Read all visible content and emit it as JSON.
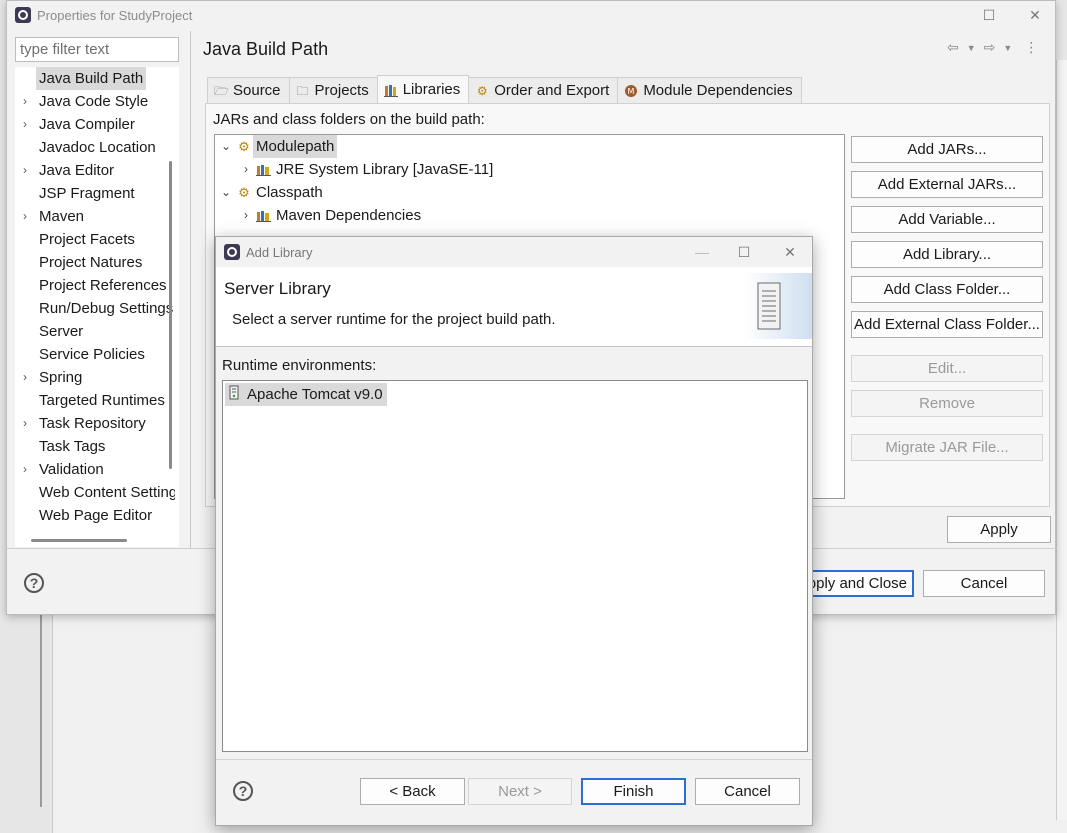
{
  "properties_window": {
    "title": "Properties for StudyProject",
    "filter_placeholder": "type filter text",
    "nav_items": [
      {
        "label": "Java Build Path",
        "expandable": false,
        "selected": true
      },
      {
        "label": "Java Code Style",
        "expandable": true
      },
      {
        "label": "Java Compiler",
        "expandable": true
      },
      {
        "label": "Javadoc Location",
        "expandable": false
      },
      {
        "label": "Java Editor",
        "expandable": true
      },
      {
        "label": "JSP Fragment",
        "expandable": false
      },
      {
        "label": "Maven",
        "expandable": true
      },
      {
        "label": "Project Facets",
        "expandable": false
      },
      {
        "label": "Project Natures",
        "expandable": false
      },
      {
        "label": "Project References",
        "expandable": false
      },
      {
        "label": "Run/Debug Settings",
        "expandable": false
      },
      {
        "label": "Server",
        "expandable": false
      },
      {
        "label": "Service Policies",
        "expandable": false
      },
      {
        "label": "Spring",
        "expandable": true
      },
      {
        "label": "Targeted Runtimes",
        "expandable": false
      },
      {
        "label": "Task Repository",
        "expandable": true
      },
      {
        "label": "Task Tags",
        "expandable": false
      },
      {
        "label": "Validation",
        "expandable": true
      },
      {
        "label": "Web Content Settings",
        "expandable": false
      },
      {
        "label": "Web Page Editor",
        "expandable": false
      }
    ],
    "page_title": "Java Build Path",
    "tabs": [
      {
        "label": "Source",
        "icon": "source-folder-icon"
      },
      {
        "label": "Projects",
        "icon": "projects-icon"
      },
      {
        "label": "Libraries",
        "icon": "libraries-icon",
        "active": true
      },
      {
        "label": "Order and Export",
        "icon": "order-export-icon"
      },
      {
        "label": "Module Dependencies",
        "icon": "module-icon"
      }
    ],
    "build_path_label": "JARs and class folders on the build path:",
    "tree": [
      {
        "label": "Modulepath",
        "icon": "modulepath-icon",
        "expanded": true,
        "level": 0,
        "selected": true
      },
      {
        "label": "JRE System Library [JavaSE-11]",
        "icon": "library-icon",
        "expanded": false,
        "level": 1
      },
      {
        "label": "Classpath",
        "icon": "classpath-icon",
        "expanded": true,
        "level": 0
      },
      {
        "label": "Maven Dependencies",
        "icon": "library-icon",
        "expanded": false,
        "level": 1
      }
    ],
    "buttons": {
      "add_jars": "Add JARs...",
      "add_external_jars": "Add External JARs...",
      "add_variable": "Add Variable...",
      "add_library": "Add Library...",
      "add_class_folder": "Add Class Folder...",
      "add_external_class_folder": "Add External Class Folder...",
      "edit": "Edit...",
      "remove": "Remove",
      "migrate_jar": "Migrate JAR File...",
      "apply": "Apply",
      "apply_and_close": "Apply and Close",
      "cancel": "Cancel"
    }
  },
  "add_library_dialog": {
    "title": "Add Library",
    "banner_title": "Server Library",
    "banner_description": "Select a server runtime for the project build path.",
    "runtime_label": "Runtime environments:",
    "runtimes": [
      {
        "label": "Apache Tomcat v9.0",
        "selected": true
      }
    ],
    "buttons": {
      "back": "< Back",
      "next": "Next >",
      "finish": "Finish",
      "cancel": "Cancel"
    }
  }
}
